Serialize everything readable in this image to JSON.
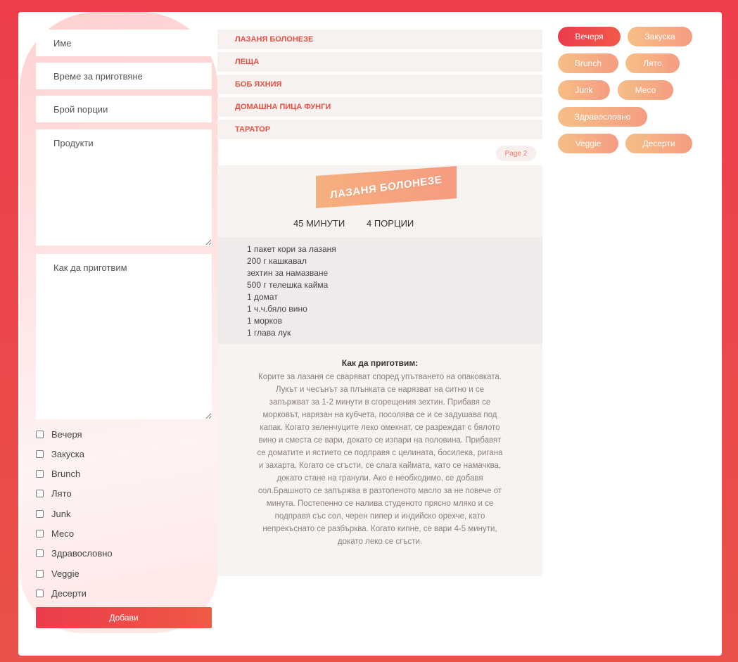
{
  "form": {
    "name_placeholder": "Име",
    "time_placeholder": "Време за приготвяне",
    "portions_placeholder": "Брой порции",
    "products_placeholder": "Продукти",
    "howto_placeholder": "Как да приготвим",
    "categories": [
      "Вечеря",
      "Закуска",
      "Brunch",
      "Лято",
      "Junk",
      "Месо",
      "Здравословно",
      "Veggie",
      "Десерти"
    ],
    "submit_label": "Добави"
  },
  "recipes": [
    "ЛАЗАНЯ БОЛОНЕЗЕ",
    "ЛЕЩА",
    "БОБ ЯХНИЯ",
    "ДОМАШНА ПИЦА ФУНГИ",
    "ТАРАТОР"
  ],
  "pagination": {
    "label": "Page 2"
  },
  "detail": {
    "title": "ЛАЗАНЯ БОЛОНЕЗЕ",
    "time": "45 МИНУТИ",
    "portions": "4 ПОРЦИИ",
    "ingredients": [
      "1 пакет кори за лазаня",
      "200 г кашкавал",
      "зехтин за намазване",
      "500 г телешка кайма",
      "1 домат",
      "1 ч.ч.бяло вино",
      "1 морков",
      "1 глава лук"
    ],
    "howto_title": "Как да приготвим:",
    "howto_text": "Корите за лазаня се сваряват според упътването на опаковката. Лукът и чесънът за плънката се нарязват на ситно и се запържват за 1-2 минути в сгорещения зехтин. Прибавя се морковът, нарязан на кубчета, посолява се и се задушава под капак. Когато зеленчуците леко омекнат, се разреждат с бялото вино и сместа се вари, докато се изпари на половина. Прибавят се доматите и ястието се подправя с целината, босилека, ригана и захарта. Когато се сгъсти, се слага каймата, като се намачква, докато стане на гранули. Ако е необходимо, се добавя сол.Брашното се запържва в разтопеното масло за не повече от минута. Постепенно се налива студеното прясно мляко и се подправя със сол, черен пипер и индийско орехче, като непрекъснато се разбърква. Когато кипне, се вари 4-5 минути, докато леко се сгъсти."
  },
  "tags": [
    "Вечеря",
    "Закуска",
    "Brunch",
    "Лято",
    "Junk",
    "Месо",
    "Здравословно",
    "Veggie",
    "Десерти"
  ],
  "active_tag": "Вечеря",
  "colors": {
    "accent": "#ec3b4c",
    "tag": "#f6b07e",
    "panel": "#f7f3f0"
  }
}
